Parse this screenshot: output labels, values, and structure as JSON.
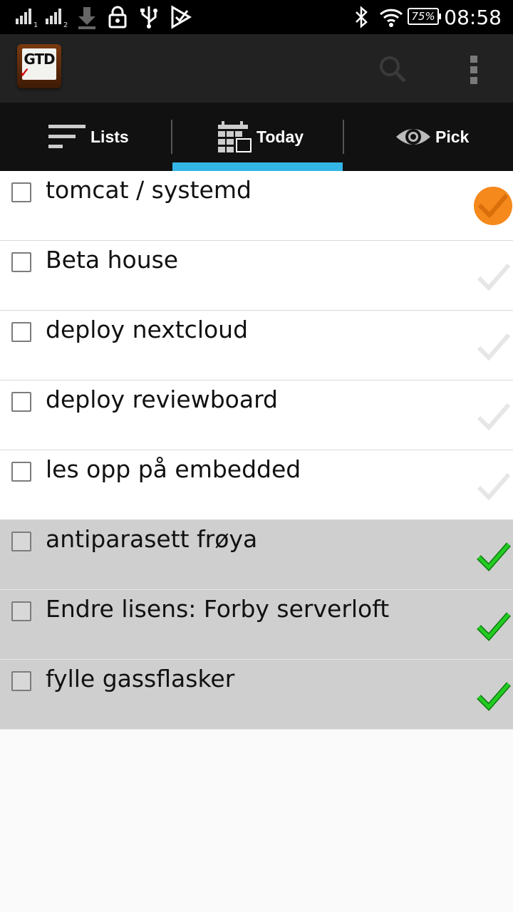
{
  "status_bar": {
    "battery_label": "75%",
    "time": "08:58",
    "sim1_label": "1",
    "sim2_label": "2"
  },
  "action_bar": {
    "logo_text": "GTD"
  },
  "tabs": [
    {
      "label": "Lists",
      "icon": "lists-icon",
      "selected": false
    },
    {
      "label": "Today",
      "icon": "calendar-icon",
      "selected": true
    },
    {
      "label": "Pick",
      "icon": "eye-icon",
      "selected": false
    }
  ],
  "colors": {
    "tab_indicator": "#33b5e5",
    "priority_badge": "#f5891c",
    "done_check": "#22cc22",
    "pending_check": "#e6e6e6",
    "done_row_bg": "#cfcfcf"
  },
  "tasks": [
    {
      "title": "tomcat / systemd",
      "checked": false,
      "status": "priority"
    },
    {
      "title": "Beta house",
      "checked": false,
      "status": "pending"
    },
    {
      "title": "deploy nextcloud",
      "checked": false,
      "status": "pending"
    },
    {
      "title": "deploy reviewboard",
      "checked": false,
      "status": "pending"
    },
    {
      "title": "les opp på embedded",
      "checked": false,
      "status": "pending"
    },
    {
      "title": "antiparasett frøya",
      "checked": false,
      "status": "done"
    },
    {
      "title": "Endre lisens: Forby serverloft",
      "checked": false,
      "status": "done"
    },
    {
      "title": "fylle gassflasker",
      "checked": false,
      "status": "done"
    }
  ]
}
